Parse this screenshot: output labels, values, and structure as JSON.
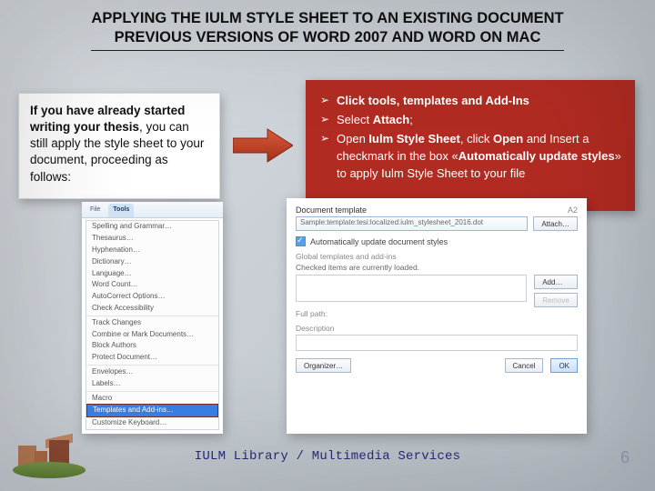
{
  "title": {
    "line1": "APPLYING THE IULM STYLE SHEET TO AN EXISTING DOCUMENT",
    "line2": "PREVIOUS VERSIONS OF WORD 2007 AND WORD ON MAC"
  },
  "intro": {
    "lead": "If you have already started writing your thesis",
    "rest": ", you can still apply the style sheet to your document, proceeding as follows:"
  },
  "steps": {
    "s1_a": "Click tools, templates and Add-Ins",
    "s2_a": "Select ",
    "s2_b": "Attach",
    "s2_c": ";",
    "s3_a": "Open ",
    "s3_b": "Iulm Style Sheet",
    "s3_c": ", click ",
    "s3_d": "Open",
    "s3_e": " and Insert a checkmark in the box «",
    "s3_f": "Automatically update styles",
    "s3_g": "» to apply Iulm Style Sheet to your file"
  },
  "shot1": {
    "tab_file": "File",
    "tab_tools": "Tools",
    "items": {
      "i0": "Spelling and Grammar…",
      "i1": "Thesaurus…",
      "i2": "Hyphenation…",
      "i3": "Dictionary…",
      "i4": "Language…",
      "i5": "Word Count…",
      "i6": "AutoCorrect Options…",
      "i7": "Check Accessibility",
      "i8": "Track Changes",
      "i9": "Combine or Mark Documents…",
      "i10": "Block Authors",
      "i11": "Protect Document…",
      "i12": "Envelopes…",
      "i13": "Labels…",
      "i14": "Macro",
      "hl": "Templates and Add-ins…",
      "i15": "Customize Keyboard…"
    }
  },
  "shot2": {
    "doc_tpl_label": "Document template",
    "path": "Sample:template:tesi:localized:iulm_stylesheet_2016.dot",
    "attach_btn": "Attach…",
    "auto_update": "Automatically update document styles",
    "global_label": "Global templates and add-ins",
    "global_note": "Checked items are currently loaded.",
    "add_btn": "Add…",
    "remove_btn": "Remove",
    "fullpath_label": "Full path:",
    "desc_label": "Description",
    "organizer_btn": "Organizer…",
    "cancel_btn": "Cancel",
    "ok_btn": "OK",
    "a2": "A2"
  },
  "footer": "IULM Library / Multimedia Services",
  "pagenum": "6"
}
